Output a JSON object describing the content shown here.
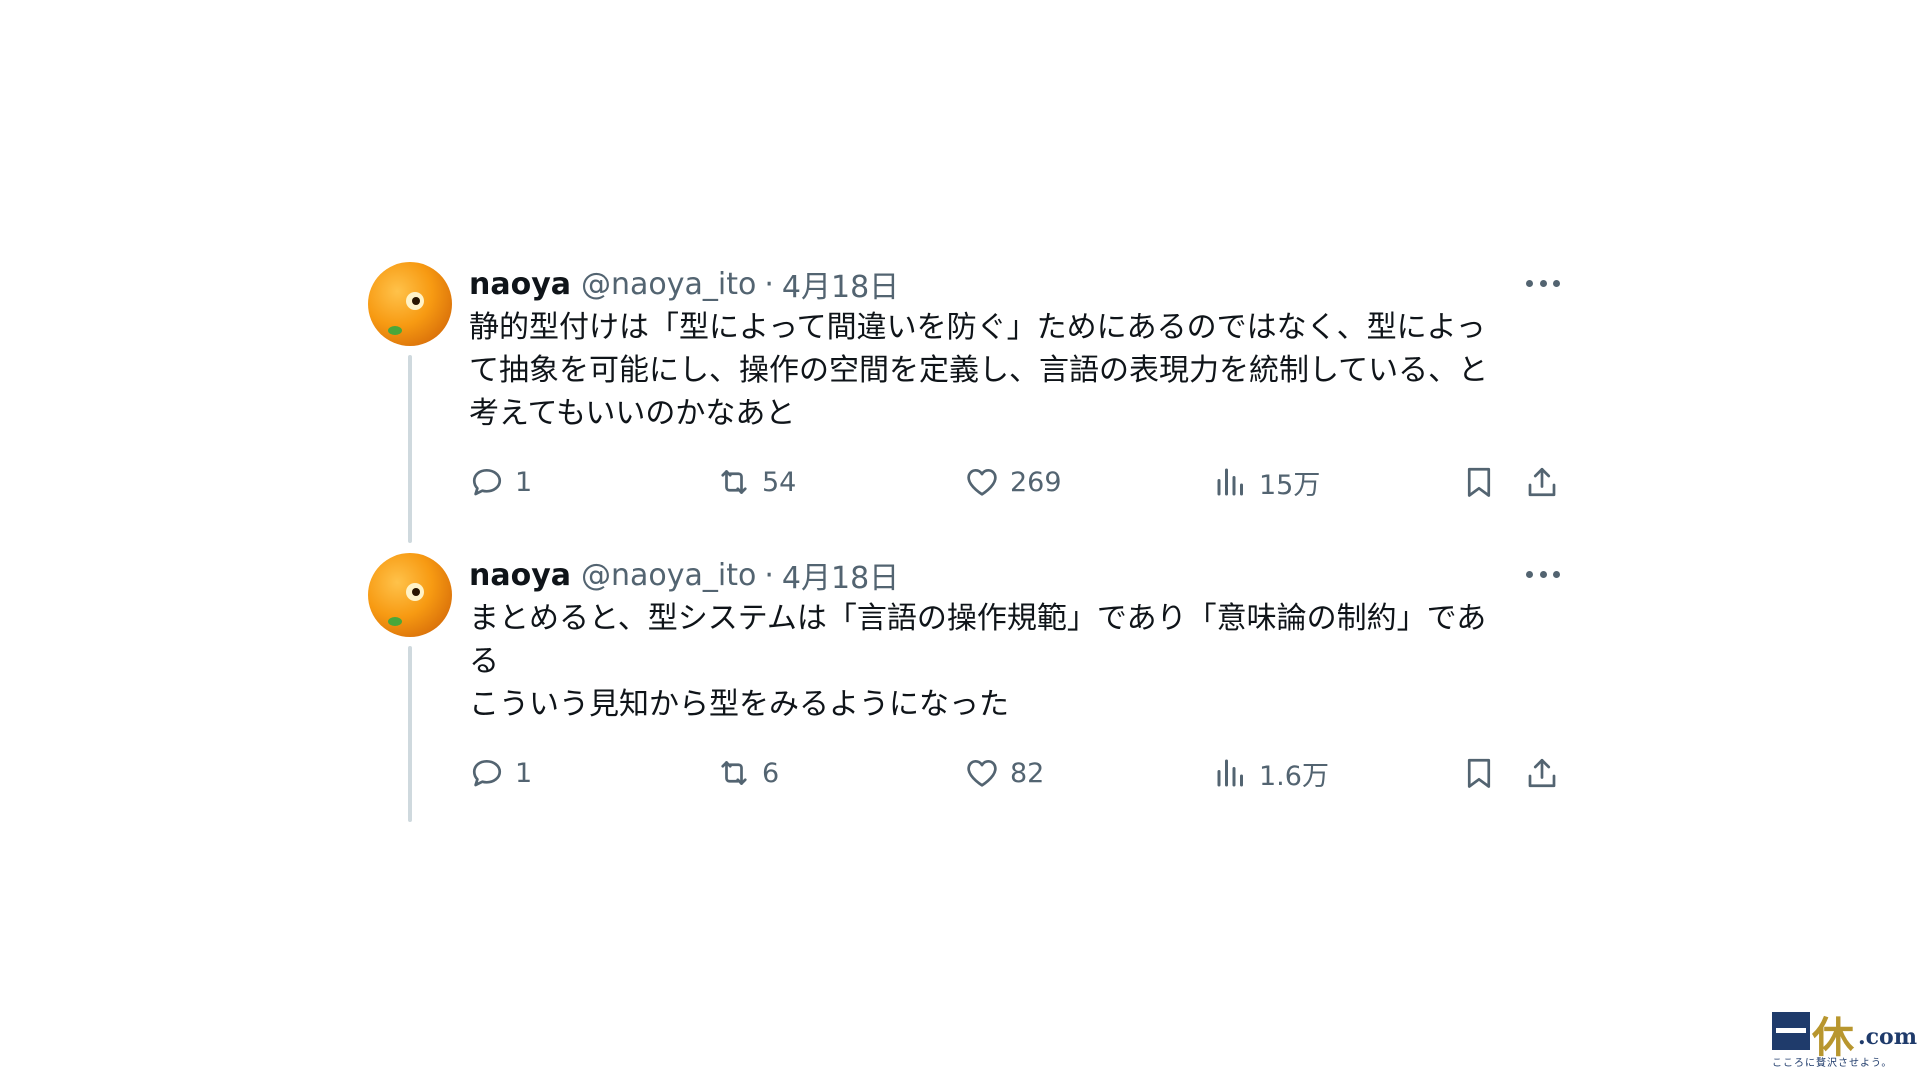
{
  "tweets": [
    {
      "name": "naoya",
      "handle": "@naoya_ito",
      "separator": "·",
      "date": "4月18日",
      "text": "静的型付けは「型によって間違いを防ぐ」ためにあるのではなく、型によっ\nて抽象を可能にし、操作の空間を定義し、言語の表現力を統制している、と\n考えてもいいのかなあと",
      "replies": "1",
      "retweets": "54",
      "likes": "269",
      "views": "15万"
    },
    {
      "name": "naoya",
      "handle": "@naoya_ito",
      "separator": "·",
      "date": "4月18日",
      "text": "まとめると、型システムは「言語の操作規範」であり「意味論の制約」であ\nる\nこういう見知から型をみるようになった",
      "replies": "1",
      "retweets": "6",
      "likes": "82",
      "views": "1.6万"
    }
  ],
  "watermark": {
    "kanji": "休",
    "suffix": ".com",
    "tagline": "こころに贅沢させよう。"
  },
  "icons": {
    "reply": "reply-icon",
    "retweet": "retweet-icon",
    "like": "heart-icon",
    "views": "views-chart-icon",
    "bookmark": "bookmark-icon",
    "share": "share-icon",
    "more": "more-icon"
  },
  "colors": {
    "text": "#0f1419",
    "secondary": "#536471",
    "thread_line": "#cfd9de",
    "logo_navy": "#1f3b6b",
    "logo_gold": "#b8962e"
  }
}
